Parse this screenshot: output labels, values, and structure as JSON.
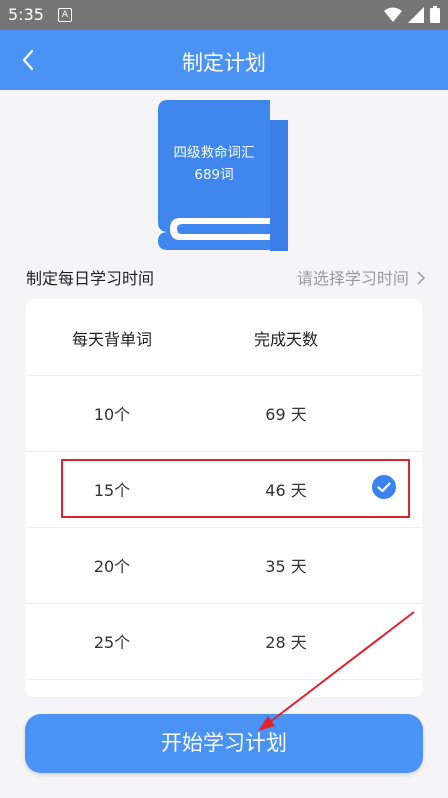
{
  "status_bar": {
    "time": "5:35",
    "notification_glyph": "A"
  },
  "app_bar": {
    "title": "制定计划"
  },
  "book": {
    "name": "四级救命词汇",
    "count": "689词"
  },
  "plan": {
    "label": "制定每日学习时间",
    "select_placeholder": "请选择学习时间"
  },
  "table": {
    "headers": [
      "每天背单词",
      "完成天数"
    ],
    "rows": [
      {
        "words": "10个",
        "days": "69 天",
        "selected": false
      },
      {
        "words": "15个",
        "days": "46 天",
        "selected": true
      },
      {
        "words": "20个",
        "days": "35 天",
        "selected": false
      },
      {
        "words": "25个",
        "days": "28 天",
        "selected": false
      }
    ]
  },
  "start_button": {
    "label": "开始学习计划"
  },
  "colors": {
    "primary": "#4a93f5",
    "annotation_red": "#e0222d",
    "check_blue": "#3a82f0"
  }
}
